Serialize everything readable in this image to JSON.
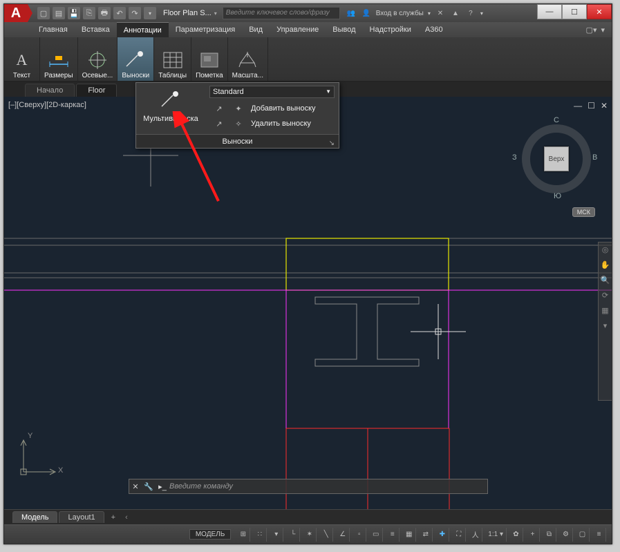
{
  "title": "Floor Plan S...",
  "search_placeholder": "Введите ключевое слово/фразу",
  "login_label": "Вход в службы",
  "menu": [
    "Главная",
    "Вставка",
    "Аннотации",
    "Параметризация",
    "Вид",
    "Управление",
    "Вывод",
    "Надстройки",
    "A360"
  ],
  "menu_active_index": 2,
  "ribbon": [
    {
      "label": "Текст"
    },
    {
      "label": "Размеры"
    },
    {
      "label": "Осевые..."
    },
    {
      "label": "Выноски"
    },
    {
      "label": "Таблицы"
    },
    {
      "label": "Пометка"
    },
    {
      "label": "Масшта..."
    }
  ],
  "ribbon_active_index": 3,
  "doctabs": [
    "Начало",
    "Floor"
  ],
  "doctab_active_index": 1,
  "view_label": "[–][Сверху][2D-каркас]",
  "viewcube": {
    "top": "Верх",
    "n": "С",
    "s": "Ю",
    "e": "В",
    "w": "З"
  },
  "ucs_label": "МСК",
  "dropdown": {
    "main_label": "Мультивыноска",
    "style": "Standard",
    "items": [
      "Добавить выноску",
      "Удалить выноску"
    ],
    "footer": "Выноски"
  },
  "cmd_placeholder": "Введите команду",
  "layout_tabs": [
    "Модель",
    "Layout1"
  ],
  "layout_active_index": 0,
  "status_model": "МОДЕЛЬ",
  "status_scale": "1:1",
  "ucs_axes": {
    "x": "X",
    "y": "Y"
  }
}
